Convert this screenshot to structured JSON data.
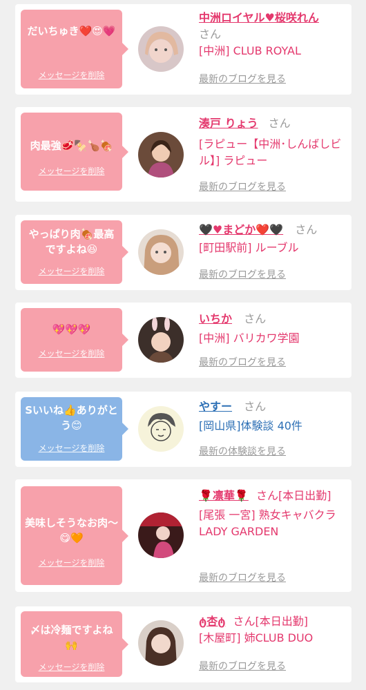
{
  "delete_label": "メッセージを削除",
  "colors": {
    "accent_pink": "#f7a1ab",
    "accent_blue": "#8ab5e6",
    "name_pink": "#e4386d",
    "name_blue": "#2c6fb5"
  },
  "messages": [
    {
      "message": "だいちゅき❤️😍💗",
      "cast_name": "中洲ロイヤル♥桜咲れん",
      "honorific": "さん",
      "shop": "[中洲] CLUB ROYAL",
      "blog_link": "最新のブログを見る",
      "bubble_color": "pink"
    },
    {
      "message": "肉最強🥩🍢🍗🍖",
      "cast_name": "湊戸 りょう",
      "honorific": "さん",
      "shop": "[ラピュー【中洲･しんばしビル】] ラピュー",
      "blog_link": "最新のブログを見る",
      "bubble_color": "pink"
    },
    {
      "message": "やっぱり肉🍖最高ですよね😆",
      "cast_name": "🖤♥まどか❤️🖤",
      "honorific": "さん",
      "shop": "[町田駅前] ルーブル",
      "blog_link": "最新のブログを見る",
      "bubble_color": "pink"
    },
    {
      "message": "💖💖💖",
      "cast_name": "いちか",
      "honorific": "さん",
      "shop": "[中洲] バリカワ学園",
      "blog_link": "最新のブログを見る",
      "bubble_color": "pink"
    },
    {
      "message": "Sいいね👍ありがとう😊",
      "cast_name": "やすー",
      "honorific": "さん",
      "shop": "[岡山県]体験談 40件",
      "blog_link": "最新の体験談を見る",
      "bubble_color": "blue"
    },
    {
      "message": "美味しそうなお肉〜😋🧡",
      "cast_name": "🌹凛華🌹",
      "honorific": "さん[本日出勤]",
      "shop": "[尾張 一宮] 熟女キャバクラ LADY GARDEN",
      "blog_link": "最新のブログを見る",
      "bubble_color": "pink"
    },
    {
      "message": "〆は冷麺ですよね🙌",
      "cast_name": "ტ杏ტ",
      "honorific": "さん[本日出勤]",
      "shop": "[木屋町] 姉CLUB DUO",
      "blog_link": "最新のブログを見る",
      "bubble_color": "pink"
    }
  ]
}
